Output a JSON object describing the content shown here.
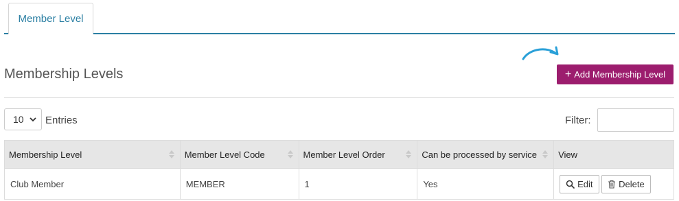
{
  "tabs": [
    {
      "label": "Member Level"
    }
  ],
  "header": {
    "title": "Membership Levels",
    "add_button_label": "Add Membership Level"
  },
  "controls": {
    "entries_value": "10",
    "entries_label": "Entries",
    "filter_label": "Filter:",
    "filter_value": ""
  },
  "table": {
    "columns": [
      "Membership Level",
      "Member Level Code",
      "Member Level Order",
      "Can be processed by service",
      "View"
    ],
    "rows": [
      {
        "membership_level": "Club Member",
        "code": "MEMBER",
        "order": "1",
        "processed": "Yes",
        "edit_label": "Edit",
        "delete_label": "Delete"
      }
    ]
  },
  "colors": {
    "accent": "#2b7fa3",
    "primary_button": "#9c1d6e",
    "arrow": "#2aa0d8",
    "header_bg": "#e6e6e6"
  },
  "icons": [
    "plus-icon",
    "curved-arrow-icon",
    "chevron-down-icon",
    "sort-icon",
    "search-icon",
    "trash-icon"
  ]
}
